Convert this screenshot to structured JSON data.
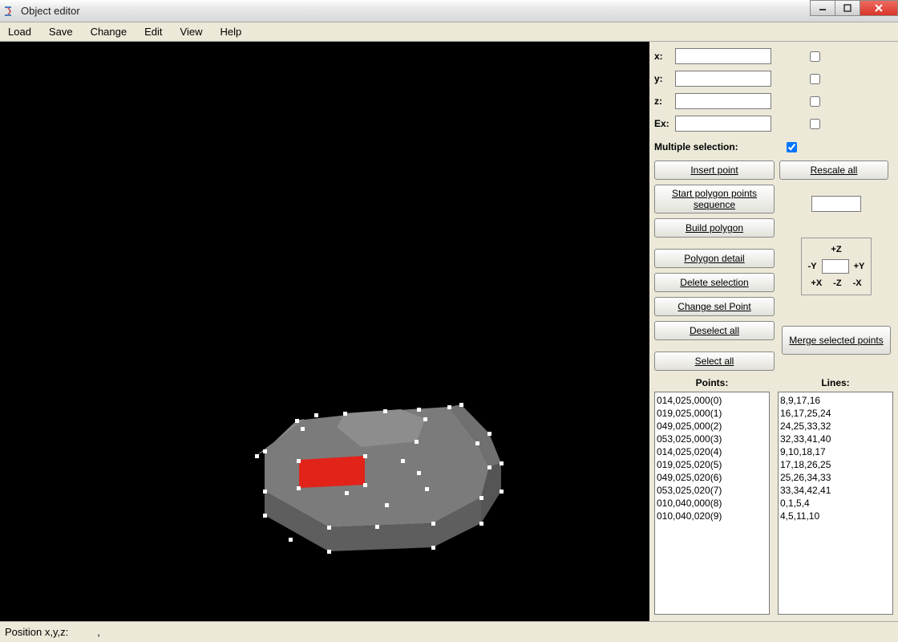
{
  "window": {
    "title": "Object editor"
  },
  "menu": [
    "Load",
    "Save",
    "Change",
    "Edit",
    "View",
    "Help"
  ],
  "coords": {
    "x_label": "x:",
    "y_label": "y:",
    "z_label": "z:",
    "ex_label": "Ex:",
    "x_value": "",
    "y_value": "",
    "z_value": "",
    "ex_value": "",
    "x_checked": false,
    "y_checked": false,
    "z_checked": false,
    "ex_checked": false
  },
  "multiple_selection": {
    "label": "Multiple selection:",
    "checked": true
  },
  "buttons": {
    "insert_point": "Insert point",
    "rescale_all": "Rescale all",
    "start_polygon": "Start polygon points sequence",
    "build_polygon": "Build polygon",
    "polygon_detail": "Polygon detail",
    "delete_selection": "Delete selection",
    "change_sel_point": "Change sel Point",
    "deselect_all": "Deselect all",
    "select_all": "Select all",
    "merge_selected": "Merge selected points"
  },
  "nav": {
    "plus_z": "+Z",
    "minus_z": "-Z",
    "plus_y": "+Y",
    "minus_y": "-Y",
    "plus_x": "+X",
    "minus_x": "-X",
    "value": ""
  },
  "rescale_value": "",
  "points_header": "Points:",
  "lines_header": "Lines:",
  "points": [
    "014,025,000(0)",
    "019,025,000(1)",
    "049,025,000(2)",
    "053,025,000(3)",
    "014,025,020(4)",
    "019,025,020(5)",
    "049,025,020(6)",
    "053,025,020(7)",
    "010,040,000(8)",
    "010,040,020(9)"
  ],
  "lines": [
    "8,9,17,16",
    "16,17,25,24",
    "24,25,33,32",
    "32,33,41,40",
    "9,10,18,17",
    "17,18,26,25",
    "25,26,34,33",
    "33,34,42,41",
    "0,1,5,4",
    "4,5,11,10"
  ],
  "status": {
    "label": "Position x,y,z:",
    "value": ","
  }
}
